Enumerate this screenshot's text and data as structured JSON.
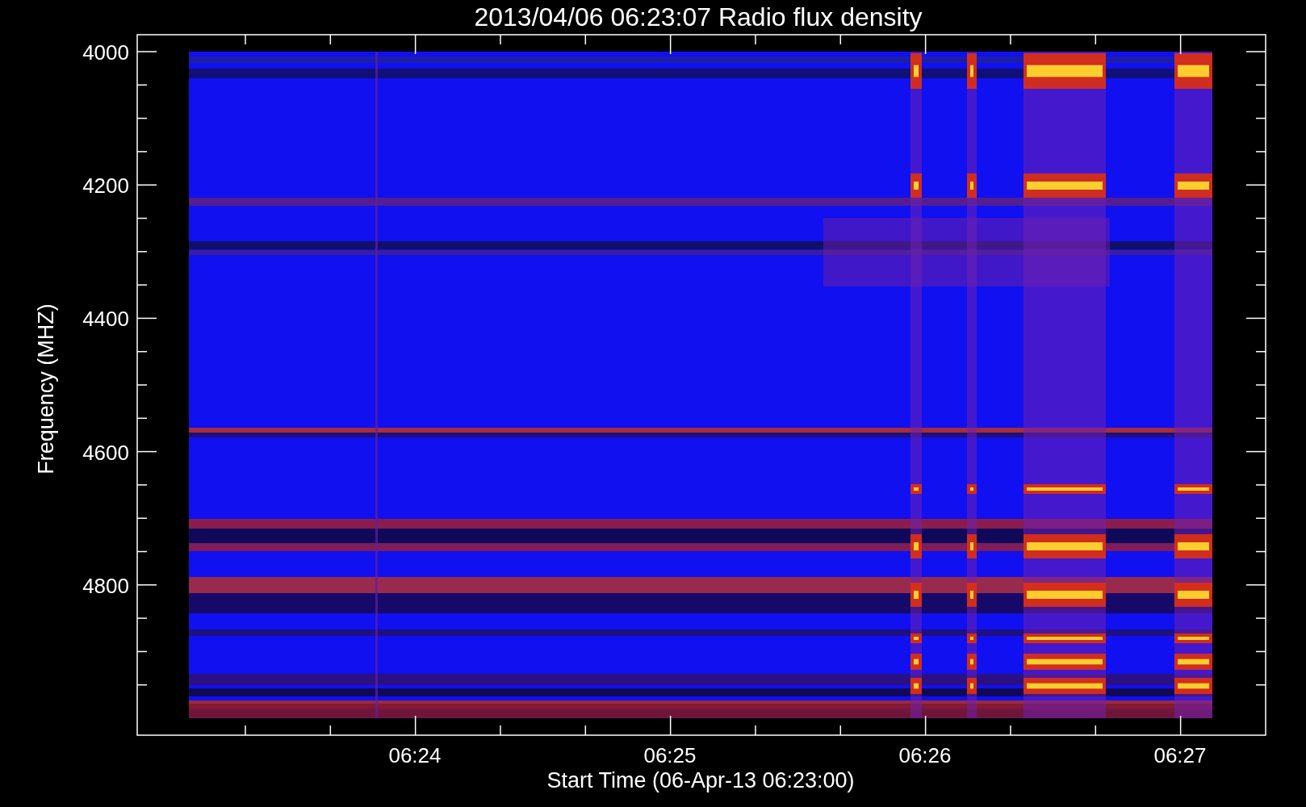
{
  "title": "2013/04/06 06:23:07 Radio flux density",
  "y_axis": {
    "label": "Frequency (MHZ)",
    "ticks": [
      "4000",
      "4200",
      "4400",
      "4600",
      "4800"
    ]
  },
  "x_axis": {
    "label": "Start Time (06-Apr-13 06:23:00)",
    "ticks": [
      "06:24",
      "06:25",
      "06:26",
      "06:27"
    ]
  }
}
